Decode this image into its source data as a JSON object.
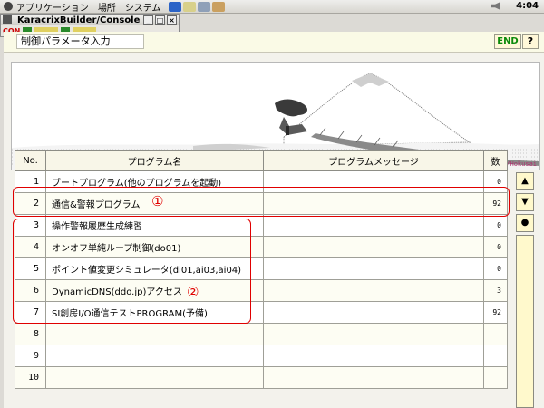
{
  "top_panel": {
    "menus": [
      "アプリケーション",
      "場所",
      "システム"
    ],
    "clock": "4:04"
  },
  "console_window": {
    "title": "KaracrixBuilder/Console",
    "con_label": "CON"
  },
  "header": {
    "title": "制御パラメータ入力",
    "end_label": "END",
    "help_label": "?"
  },
  "banner": {
    "credit": "Kazuyoshi/Kanazawa/Hokusai"
  },
  "table": {
    "columns": [
      "No.",
      "プログラム名",
      "プログラムメッセージ",
      "数"
    ],
    "rows": [
      {
        "no": "1",
        "name": "ブートプログラム(他のプログラムを起動)",
        "message": "",
        "count": "0"
      },
      {
        "no": "2",
        "name": "通信&警報プログラム",
        "message": "",
        "count": "92"
      },
      {
        "no": "3",
        "name": "操作警報履歴生成練習",
        "message": "",
        "count": "0"
      },
      {
        "no": "4",
        "name": "オンオフ単純ループ制御(do01)",
        "message": "",
        "count": "0"
      },
      {
        "no": "5",
        "name": "ポイント値変更シミュレータ(di01,ai03,ai04)",
        "message": "",
        "count": "0"
      },
      {
        "no": "6",
        "name": "DynamicDNS(ddo.jp)アクセス",
        "message": "",
        "count": "3"
      },
      {
        "no": "7",
        "name": "SI創房I/O通信テストPROGRAM(予備)",
        "message": "",
        "count": "92"
      },
      {
        "no": "8",
        "name": "",
        "message": "",
        "count": ""
      },
      {
        "no": "9",
        "name": "",
        "message": "",
        "count": ""
      },
      {
        "no": "10",
        "name": "",
        "message": "",
        "count": ""
      }
    ]
  },
  "side_buttons": {
    "up": "▲",
    "down": "▼",
    "dot": "●"
  },
  "annotations": {
    "one": "①",
    "two": "②"
  },
  "colors": {
    "annotation": "#e00000",
    "end_text": "#0a8a0a",
    "button_bg": "#fff9cc"
  }
}
